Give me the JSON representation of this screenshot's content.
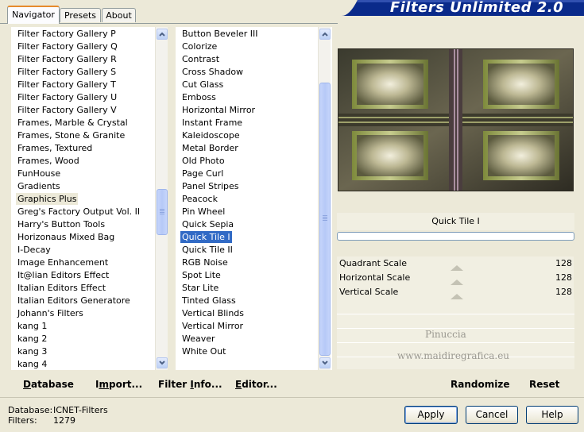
{
  "tabs": [
    {
      "label": "Navigator",
      "active": true
    },
    {
      "label": "Presets",
      "active": false
    },
    {
      "label": "About",
      "active": false
    }
  ],
  "app_title": "Filters Unlimited 2.0",
  "categories": {
    "items": [
      "Filter Factory Gallery P",
      "Filter Factory Gallery Q",
      "Filter Factory Gallery R",
      "Filter Factory Gallery S",
      "Filter Factory Gallery T",
      "Filter Factory Gallery U",
      "Filter Factory Gallery V",
      "Frames, Marble & Crystal",
      "Frames, Stone & Granite",
      "Frames, Textured",
      "Frames, Wood",
      "FunHouse",
      "Gradients",
      "Graphics Plus",
      "Greg's Factory Output Vol. II",
      "Harry's Button Tools",
      "Horizonaus Mixed Bag",
      "I-Decay",
      "Image Enhancement",
      "It@lian Editors Effect",
      "Italian Editors Effect",
      "Italian Editors Generatore",
      "Johann's Filters",
      "kang 1",
      "kang 2",
      "kang 3",
      "kang 4"
    ],
    "selected": "Graphics Plus"
  },
  "filters": {
    "items": [
      "Button Beveler III",
      "Colorize",
      "Contrast",
      "Cross Shadow",
      "Cut Glass",
      "Emboss",
      "Horizontal Mirror",
      "Instant Frame",
      "Kaleidoscope",
      "Metal Border",
      "Old Photo",
      "Page Curl",
      "Panel Stripes",
      "Peacock",
      "Pin Wheel",
      "Quick Sepia",
      "Quick Tile I",
      "Quick Tile II",
      "RGB Noise",
      "Spot Lite",
      "Star Lite",
      "Tinted Glass",
      "Vertical Blinds",
      "Vertical Mirror",
      "Weaver",
      "White Out"
    ],
    "selected": "Quick Tile I"
  },
  "toolbar": {
    "database": {
      "underline": "D",
      "rest": "atabase"
    },
    "import": {
      "pre": "I",
      "underline": "m",
      "rest": "port..."
    },
    "filter_info": {
      "pre": "Filter ",
      "underline": "I",
      "rest": "nfo..."
    },
    "editor": {
      "underline": "E",
      "rest": "ditor..."
    },
    "randomize": "Randomize",
    "reset": "Reset"
  },
  "filter_name": "Quick Tile I",
  "params": [
    {
      "label": "Quadrant Scale",
      "value": "128"
    },
    {
      "label": "Horizontal Scale",
      "value": "128"
    },
    {
      "label": "Vertical Scale",
      "value": "128"
    }
  ],
  "watermark": {
    "line1": "Pinuccia",
    "line2": "www.maidiregrafica.eu"
  },
  "status": {
    "database_label": "Database:",
    "database_value": "ICNET-Filters",
    "filters_label": "Filters:",
    "filters_value": "1279"
  },
  "buttons": {
    "apply": "Apply",
    "cancel": "Cancel",
    "help": "Help"
  },
  "colors": {
    "selection": "#316ac5",
    "banner": "#0a2a8a",
    "tab_accent": "#e68b2c"
  }
}
